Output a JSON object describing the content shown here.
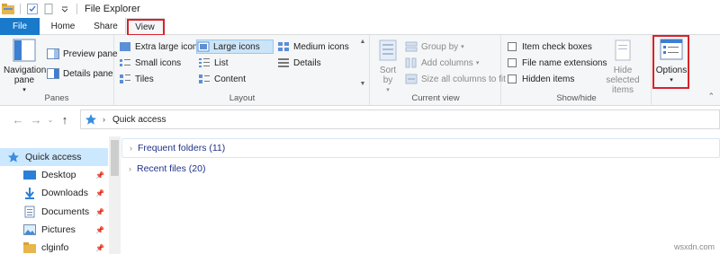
{
  "window": {
    "title": "File Explorer"
  },
  "tabs": {
    "file": "File",
    "home": "Home",
    "share": "Share",
    "view": "View"
  },
  "ribbon": {
    "panes": {
      "label": "Panes",
      "navigation_pane": "Navigation pane",
      "preview_pane": "Preview pane",
      "details_pane": "Details pane"
    },
    "layout": {
      "label": "Layout",
      "extra_large_icons": "Extra large icons",
      "large_icons": "Large icons",
      "medium_icons": "Medium icons",
      "small_icons": "Small icons",
      "list": "List",
      "details": "Details",
      "tiles": "Tiles",
      "content": "Content"
    },
    "current_view": {
      "label": "Current view",
      "sort_by": "Sort by",
      "group_by": "Group by",
      "add_columns": "Add columns",
      "size_all_columns": "Size all columns to fit"
    },
    "show_hide": {
      "label": "Show/hide",
      "item_check_boxes": "Item check boxes",
      "file_name_extensions": "File name extensions",
      "hidden_items": "Hidden items",
      "hide_selected_items": "Hide selected items"
    },
    "options": {
      "label": "Options"
    }
  },
  "address": {
    "path": "Quick access"
  },
  "nav": {
    "quick_access": "Quick access",
    "desktop": "Desktop",
    "downloads": "Downloads",
    "documents": "Documents",
    "pictures": "Pictures",
    "clginfo": "clginfo"
  },
  "content": {
    "frequent_folders": "Frequent folders (11)",
    "recent_files": "Recent files (20)"
  },
  "watermark": "wsxdn.com",
  "colors": {
    "accent": "#1979ca",
    "highlight": "#d6232b",
    "selection": "#cce8ff"
  }
}
